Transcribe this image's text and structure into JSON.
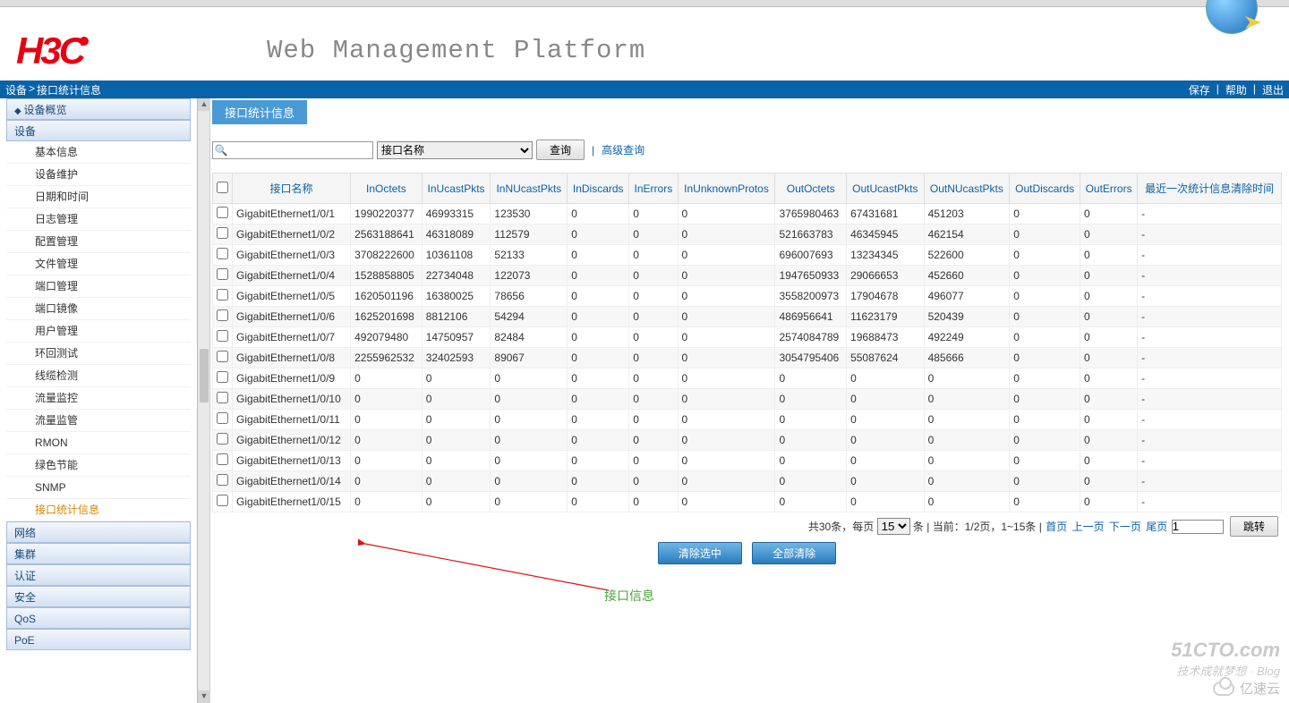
{
  "header": {
    "logo_text": "H3C",
    "platform_title": "Web Management Platform"
  },
  "breadcrumb": {
    "part1": "设备",
    "sep": ">",
    "part2": "接口统计信息",
    "save": "保存",
    "help": "帮助",
    "logout": "退出"
  },
  "sidebar": {
    "top_item": "设备概览",
    "categories": [
      {
        "label": "设备",
        "expanded": true,
        "items": [
          "基本信息",
          "设备维护",
          "日期和时间",
          "日志管理",
          "配置管理",
          "文件管理",
          "端口管理",
          "端口镜像",
          "用户管理",
          "环回测试",
          "线缆检测",
          "流量监控",
          "流量监管",
          "RMON",
          "绿色节能",
          "SNMP",
          "接口统计信息"
        ],
        "active_index": 16
      },
      {
        "label": "网络"
      },
      {
        "label": "集群"
      },
      {
        "label": "认证"
      },
      {
        "label": "安全"
      },
      {
        "label": "QoS"
      },
      {
        "label": "PoE"
      }
    ]
  },
  "content": {
    "tab_label": "接口统计信息",
    "search": {
      "placeholder": "",
      "filter_options": [
        "接口名称"
      ],
      "filter_selected": "接口名称",
      "query_btn": "查询",
      "advanced": "高级查询"
    },
    "columns": [
      "接口名称",
      "InOctets",
      "InUcastPkts",
      "InNUcastPkts",
      "InDiscards",
      "InErrors",
      "InUnknownProtos",
      "OutOctets",
      "OutUcastPkts",
      "OutNUcastPkts",
      "OutDiscards",
      "OutErrors",
      "最近一次统计信息清除时间"
    ],
    "rows": [
      [
        "GigabitEthernet1/0/1",
        "1990220377",
        "46993315",
        "123530",
        "0",
        "0",
        "0",
        "3765980463",
        "67431681",
        "451203",
        "0",
        "0",
        "-"
      ],
      [
        "GigabitEthernet1/0/2",
        "2563188641",
        "46318089",
        "112579",
        "0",
        "0",
        "0",
        "521663783",
        "46345945",
        "462154",
        "0",
        "0",
        "-"
      ],
      [
        "GigabitEthernet1/0/3",
        "3708222600",
        "10361108",
        "52133",
        "0",
        "0",
        "0",
        "696007693",
        "13234345",
        "522600",
        "0",
        "0",
        "-"
      ],
      [
        "GigabitEthernet1/0/4",
        "1528858805",
        "22734048",
        "122073",
        "0",
        "0",
        "0",
        "1947650933",
        "29066653",
        "452660",
        "0",
        "0",
        "-"
      ],
      [
        "GigabitEthernet1/0/5",
        "1620501196",
        "16380025",
        "78656",
        "0",
        "0",
        "0",
        "3558200973",
        "17904678",
        "496077",
        "0",
        "0",
        "-"
      ],
      [
        "GigabitEthernet1/0/6",
        "1625201698",
        "8812106",
        "54294",
        "0",
        "0",
        "0",
        "486956641",
        "11623179",
        "520439",
        "0",
        "0",
        "-"
      ],
      [
        "GigabitEthernet1/0/7",
        "492079480",
        "14750957",
        "82484",
        "0",
        "0",
        "0",
        "2574084789",
        "19688473",
        "492249",
        "0",
        "0",
        "-"
      ],
      [
        "GigabitEthernet1/0/8",
        "2255962532",
        "32402593",
        "89067",
        "0",
        "0",
        "0",
        "3054795406",
        "55087624",
        "485666",
        "0",
        "0",
        "-"
      ],
      [
        "GigabitEthernet1/0/9",
        "0",
        "0",
        "0",
        "0",
        "0",
        "0",
        "0",
        "0",
        "0",
        "0",
        "0",
        "-"
      ],
      [
        "GigabitEthernet1/0/10",
        "0",
        "0",
        "0",
        "0",
        "0",
        "0",
        "0",
        "0",
        "0",
        "0",
        "0",
        "-"
      ],
      [
        "GigabitEthernet1/0/11",
        "0",
        "0",
        "0",
        "0",
        "0",
        "0",
        "0",
        "0",
        "0",
        "0",
        "0",
        "-"
      ],
      [
        "GigabitEthernet1/0/12",
        "0",
        "0",
        "0",
        "0",
        "0",
        "0",
        "0",
        "0",
        "0",
        "0",
        "0",
        "-"
      ],
      [
        "GigabitEthernet1/0/13",
        "0",
        "0",
        "0",
        "0",
        "0",
        "0",
        "0",
        "0",
        "0",
        "0",
        "0",
        "-"
      ],
      [
        "GigabitEthernet1/0/14",
        "0",
        "0",
        "0",
        "0",
        "0",
        "0",
        "0",
        "0",
        "0",
        "0",
        "0",
        "-"
      ],
      [
        "GigabitEthernet1/0/15",
        "0",
        "0",
        "0",
        "0",
        "0",
        "0",
        "0",
        "0",
        "0",
        "0",
        "0",
        "-"
      ]
    ],
    "pager": {
      "total_prefix": "共30条，每页",
      "per_page": "15",
      "total_suffix": "条 | 当前：1/2页，1~15条 |",
      "first": "首页",
      "prev": "上一页",
      "next": "下一页",
      "last": "尾页",
      "goto_value": "1",
      "goto_btn": "跳转"
    },
    "actions": {
      "clear_selected": "清除选中",
      "clear_all": "全部清除"
    },
    "annotation_label": "接口信息"
  },
  "watermark": {
    "l1": "51CTO.com",
    "l2": "技术成就梦想 · Blog",
    "l3": "亿速云"
  }
}
